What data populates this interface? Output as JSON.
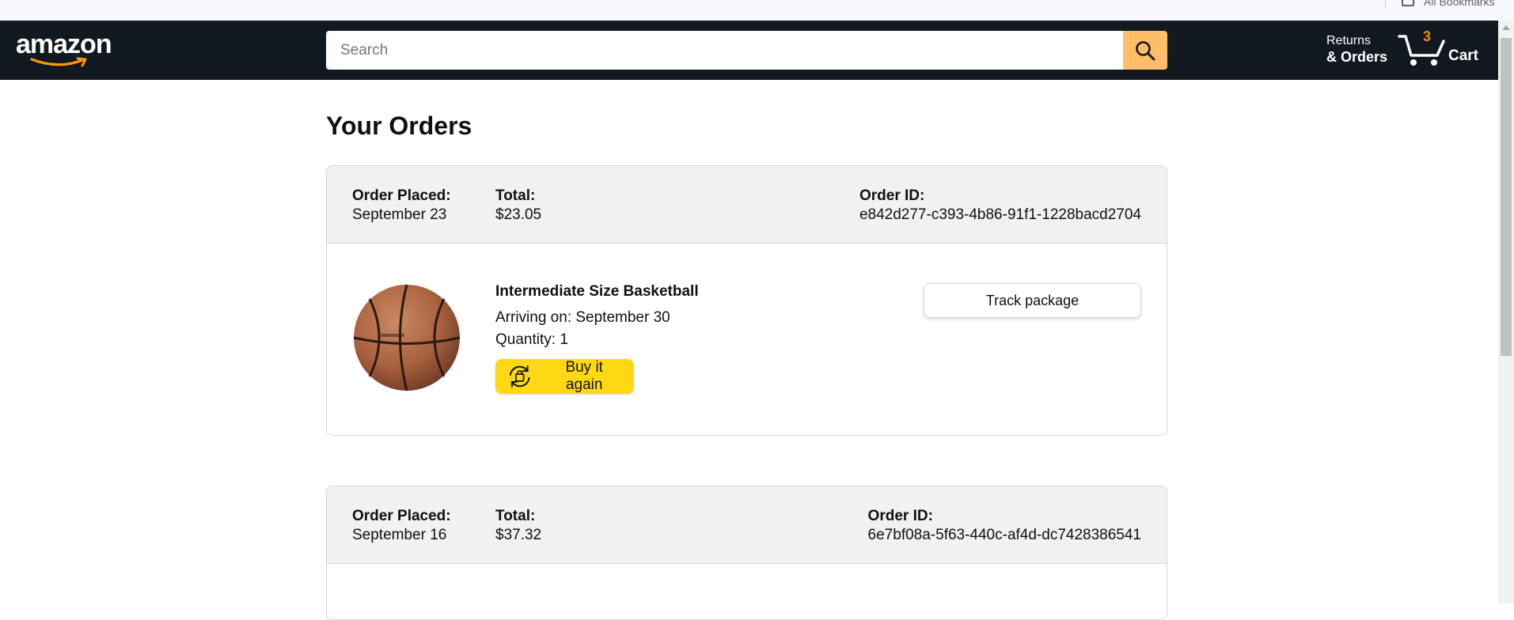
{
  "browser": {
    "bookmarks_label": "All Bookmarks"
  },
  "header": {
    "logo": "amazon",
    "search": {
      "placeholder": "Search",
      "value": ""
    },
    "returns_line1": "Returns",
    "returns_line2": "& Orders",
    "cart_count": "3",
    "cart_label": "Cart"
  },
  "page": {
    "title": "Your Orders"
  },
  "orders": [
    {
      "placed_label": "Order Placed:",
      "placed_date": "September 23",
      "total_label": "Total:",
      "total": "$23.05",
      "id_label": "Order ID:",
      "id": "e842d277-c393-4b86-91f1-1228bacd2704",
      "item": {
        "name": "Intermediate Size Basketball",
        "arriving": "Arriving on: September 30",
        "quantity": "Quantity: 1",
        "buy_again_label": "Buy it again",
        "track_label": "Track package",
        "image_icon": "basketball-image"
      }
    },
    {
      "placed_label": "Order Placed:",
      "placed_date": "September 16",
      "total_label": "Total:",
      "total": "$37.32",
      "id_label": "Order ID:",
      "id": "6e7bf08a-5f63-440c-af4d-dc7428386541"
    }
  ],
  "colors": {
    "header_bg": "#131921",
    "search_button": "#febd69",
    "buy_again": "#ffd814",
    "cart_count": "#f08804",
    "order_header_bg": "#f0f2f2"
  }
}
